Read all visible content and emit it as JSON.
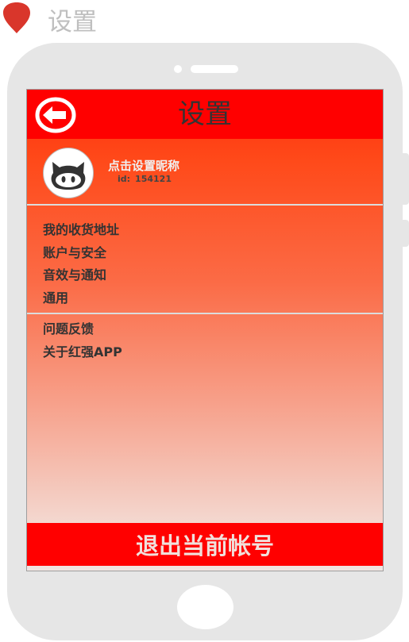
{
  "page_tag": {
    "title": "设置"
  },
  "screen": {
    "header": {
      "title": "设置",
      "back_icon": "back-arrow-circle-icon"
    },
    "profile": {
      "avatar_icon": "octocat-icon",
      "nickname": "点击设置昵称",
      "id_label": "id:",
      "id_value": "154121"
    },
    "menu_group_1": [
      {
        "label": "我的收货地址"
      },
      {
        "label": "账户与安全"
      },
      {
        "label": "音效与通知"
      },
      {
        "label": "通用"
      }
    ],
    "menu_group_2": [
      {
        "label": "问题反馈"
      },
      {
        "label": "关于红强APP"
      }
    ],
    "logout": {
      "label": "退出当前帐号"
    }
  },
  "colors": {
    "header_red": "#ff0000",
    "gradient_top": "#ff2e0a",
    "gradient_bottom": "#f1e5e2",
    "text_dark": "#333333",
    "page_tag_gray": "#bfbfbf",
    "phone_frame": "#e6e6e6"
  }
}
